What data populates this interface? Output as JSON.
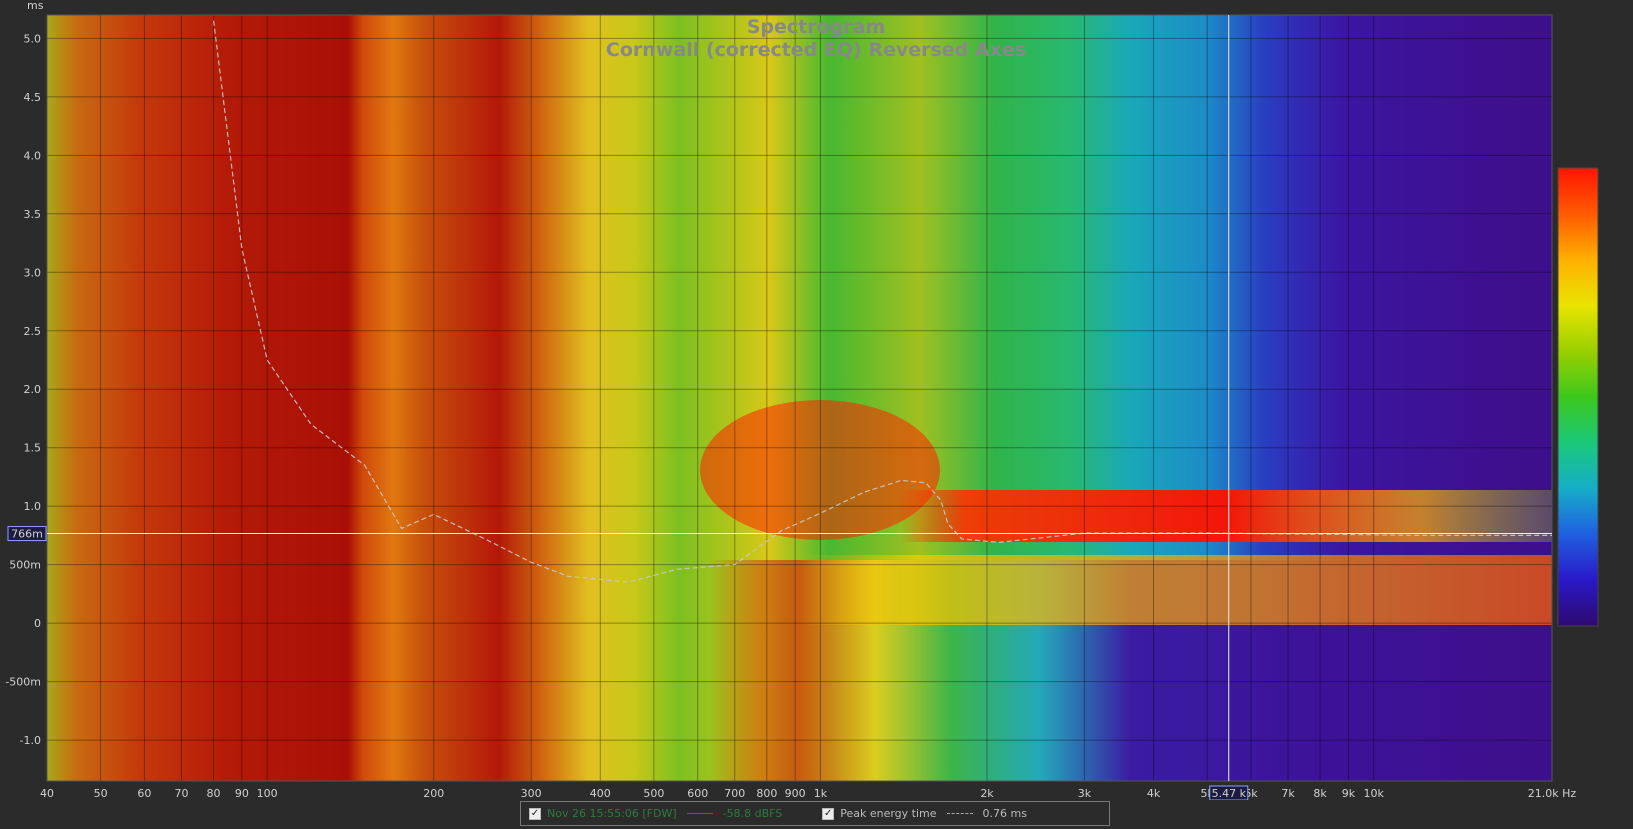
{
  "chart_data": {
    "type": "heatmap",
    "title": "Spectrogram",
    "subtitle": "Cornwall (corrected EQ) Reversed Axes",
    "xlabel": "Hz",
    "ylabel": "ms",
    "x_scale": "log",
    "xlim": [
      40,
      21000
    ],
    "ylim": [
      -1.35,
      5.2
    ],
    "x_ticks": [
      40,
      50,
      60,
      70,
      80,
      90,
      100,
      200,
      300,
      400,
      500,
      600,
      700,
      800,
      900,
      1000,
      2000,
      3000,
      4000,
      5000,
      6000,
      7000,
      8000,
      9000,
      10000,
      21000
    ],
    "x_tick_labels": [
      "40",
      "50",
      "60",
      "70",
      "80",
      "90",
      "100",
      "200",
      "300",
      "400",
      "500",
      "600",
      "700",
      "800",
      "900",
      "1k",
      "2k",
      "3k",
      "4k",
      "5k",
      "6k",
      "7k",
      "8k",
      "9k",
      "10k",
      "21.0k Hz"
    ],
    "y_ticks": [
      -1.0,
      -0.5,
      0,
      0.5,
      1.0,
      1.5,
      2.0,
      2.5,
      3.0,
      3.5,
      4.0,
      4.5,
      5.0
    ],
    "y_tick_labels": [
      "-1.0",
      "-500m",
      "0",
      "500m",
      "1.0",
      "1.5",
      "2.0",
      "2.5",
      "3.0",
      "3.5",
      "4.0",
      "4.5",
      "5.0"
    ],
    "grid": true,
    "colorbar": {
      "min": -97,
      "max": -57,
      "ticks": [
        -57,
        -59,
        -63,
        -67,
        -71,
        -75,
        -79,
        -83,
        -87,
        -91,
        -95,
        -97
      ],
      "colors": [
        "#ff1500",
        "#ff5a00",
        "#ffb000",
        "#e9e400",
        "#9ad000",
        "#3cc81c",
        "#1ac87a",
        "#16aec8",
        "#1f5fe0",
        "#2a18c8",
        "#3c0c9a",
        "#2e0a6e"
      ]
    },
    "series": [
      {
        "name": "Peak energy time",
        "x": [
          80,
          90,
          100,
          120,
          150,
          175,
          200,
          250,
          300,
          350,
          450,
          550,
          700,
          850,
          1000,
          1200,
          1400,
          1550,
          1650,
          1700,
          1800,
          2100,
          3000,
          5000,
          8000,
          12000,
          21000
        ],
        "y": [
          5.15,
          3.2,
          2.25,
          1.7,
          1.35,
          0.81,
          0.93,
          0.71,
          0.52,
          0.4,
          0.35,
          0.46,
          0.5,
          0.79,
          0.94,
          1.12,
          1.22,
          1.2,
          1.05,
          0.85,
          0.72,
          0.69,
          0.77,
          0.77,
          0.76,
          0.75,
          0.75
        ]
      }
    ],
    "cursor": {
      "time_label": "766m",
      "freq_label": "5.47 k",
      "time": 0.766,
      "freq": 5470
    }
  },
  "legend": {
    "item1_label": "Nov 26 15:55:06 [FDW]",
    "item1_value": "-58.8 dBFS",
    "item2_label": "Peak energy time",
    "item2_value": "0.76 ms",
    "check_mark": "✓"
  }
}
